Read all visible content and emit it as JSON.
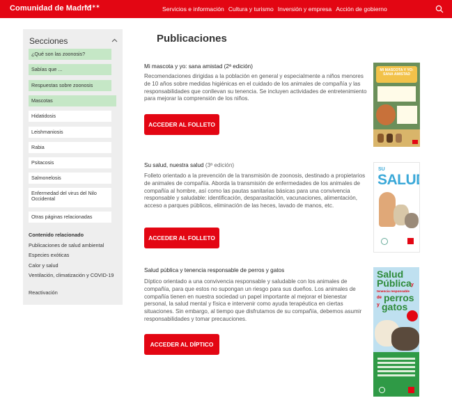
{
  "header": {
    "brand": "Comunidad de Madrid",
    "nav": [
      "Servicios e información",
      "Cultura y turismo",
      "Inversión y empresa",
      "Acción de gobierno"
    ],
    "colors": {
      "brand_red": "#e30613",
      "active_green": "#c5e7c6"
    }
  },
  "sidebar": {
    "title": "Secciones",
    "items": [
      {
        "label": "¿Qué son las zoonosis?"
      },
      {
        "label": "Sabías que ..."
      },
      {
        "label": "Respuestas sobre zoonosis"
      },
      {
        "label": "Mascotas"
      },
      {
        "label": "Hidatidosis"
      },
      {
        "label": "Leishmaniosis"
      },
      {
        "label": "Rabia"
      },
      {
        "label": "Psitacosis"
      },
      {
        "label": "Salmonelosis"
      },
      {
        "label": "Enfermedad del virus del Nilo Occidental"
      },
      {
        "label": "Otras páginas relacionadas"
      }
    ],
    "related_title": "Contenido relacionado",
    "related": [
      "Publicaciones de salud ambiental",
      "Especies exóticas",
      "Calor y salud",
      "Ventilación, climatización y COVID-19",
      "Reactivación"
    ]
  },
  "main": {
    "title": "Publicaciones",
    "publications": [
      {
        "title": "Mi mascota y yo: sana amistad (2ª edición)",
        "description": "Recomendaciones dirigidas a la población en general y especialmente a niños menores de 10 años sobre medidas higiénicas en el cuidado de los animales de compañía y las responsabilidades que conllevan su tenencia. Se incluyen actividades de entretenimiento para mejorar la comprensión de los niños.",
        "button": "ACCEDER AL FOLLETO",
        "cover_text": "MI MASCOTA Y YO: SANA AMISTAD"
      },
      {
        "title": "Su salud, nuestra salud",
        "edition": "(3ª edición)",
        "description": "Folleto orientado a la prevención de la transmisión de zoonosis, destinado a propietarios de animales de compañía. Aborda la transmisión de enfermedades de los animales de compañía al hombre, así como las pautas sanitarias básicas para una convivencia responsable y saludable: identificación, desparasitación, vacunaciones, alimentación, acceso a parques públicos, eliminación de las heces, lavado de manos, etc.",
        "button": "ACCEDER AL FOLLETO",
        "cover_text": "SALUD"
      },
      {
        "title": "Salud pública y tenencia responsable de perros y gatos",
        "description": "Díptico orientado a una convivencia responsable y saludable con los animales de compañía, para que estos no supongan un riesgo para sus dueños. Los animales de compañía tienen en nuestra sociedad un papel importante al mejorar el bienestar personal, la salud mental y física e intervenir como ayuda terapéutica en ciertas situaciones. Sin embargo, al tiempo que disfrutamos de su compañía, debemos asumir responsabilidades y tomar precauciones.",
        "button": "ACCEDER AL DÍPTICO",
        "cover_text": [
          "Salud",
          "Pública",
          "y",
          "tenencia responsable",
          "de",
          "perros",
          "y",
          "gatos"
        ]
      }
    ]
  }
}
